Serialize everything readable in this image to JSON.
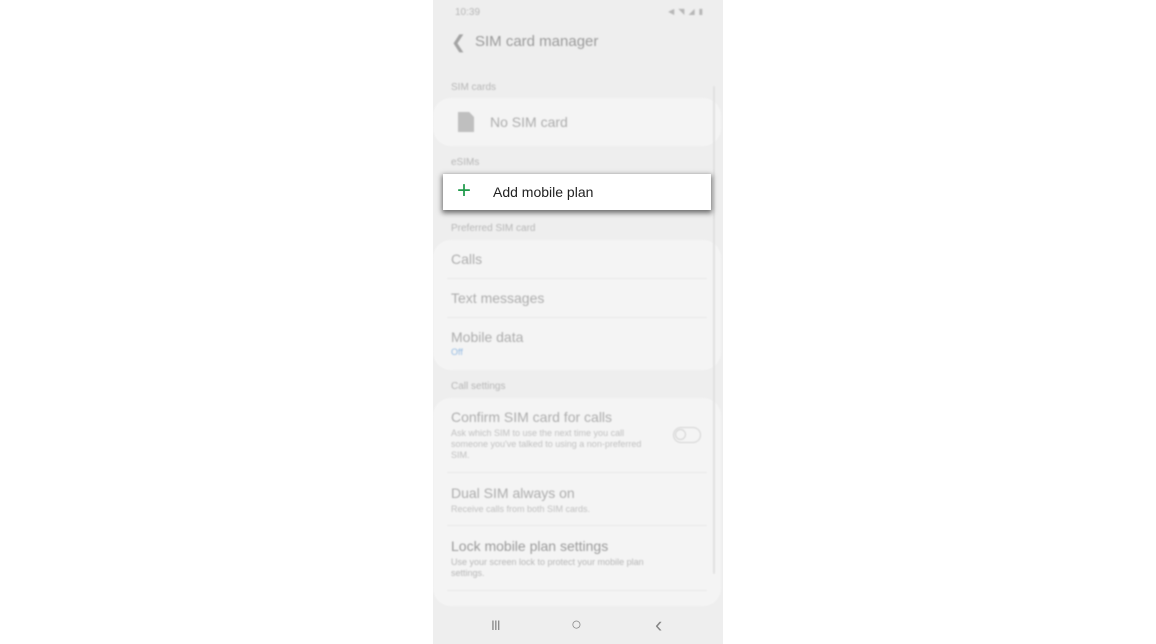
{
  "status_bar": {
    "time": "10:39",
    "icons": [
      "mute-icon",
      "wifi-icon",
      "signal-icon",
      "battery-icon"
    ]
  },
  "app_bar": {
    "title": "SIM card manager",
    "back_icon": "chevron-left-icon"
  },
  "sections": {
    "sim_cards": {
      "label": "SIM cards",
      "item": {
        "title": "No SIM card",
        "icon": "sim-card-icon"
      }
    },
    "esims": {
      "label": "eSIMs",
      "item": {
        "title": "Add mobile plan",
        "icon": "plus-icon",
        "accent": "#1f9a4a"
      }
    },
    "preferred": {
      "label": "Preferred SIM card",
      "items": [
        {
          "title": "Calls"
        },
        {
          "title": "Text messages"
        },
        {
          "title": "Mobile data",
          "subtitle": "Off",
          "subtitle_color": "#4a90d9"
        }
      ]
    },
    "call_settings": {
      "label": "Call settings",
      "items": [
        {
          "title": "Confirm SIM card for calls",
          "subtitle": "Ask which SIM to use the next time you call someone you've talked to using a non-preferred SIM.",
          "toggle": false
        },
        {
          "title": "Dual SIM always on",
          "subtitle": "Receive calls from both SIM cards."
        },
        {
          "title": "Lock mobile plan settings",
          "subtitle": "Use your screen lock to protect your mobile plan settings."
        }
      ]
    }
  },
  "nav_bar": {
    "recents": "III",
    "home": "○",
    "back": "‹"
  }
}
